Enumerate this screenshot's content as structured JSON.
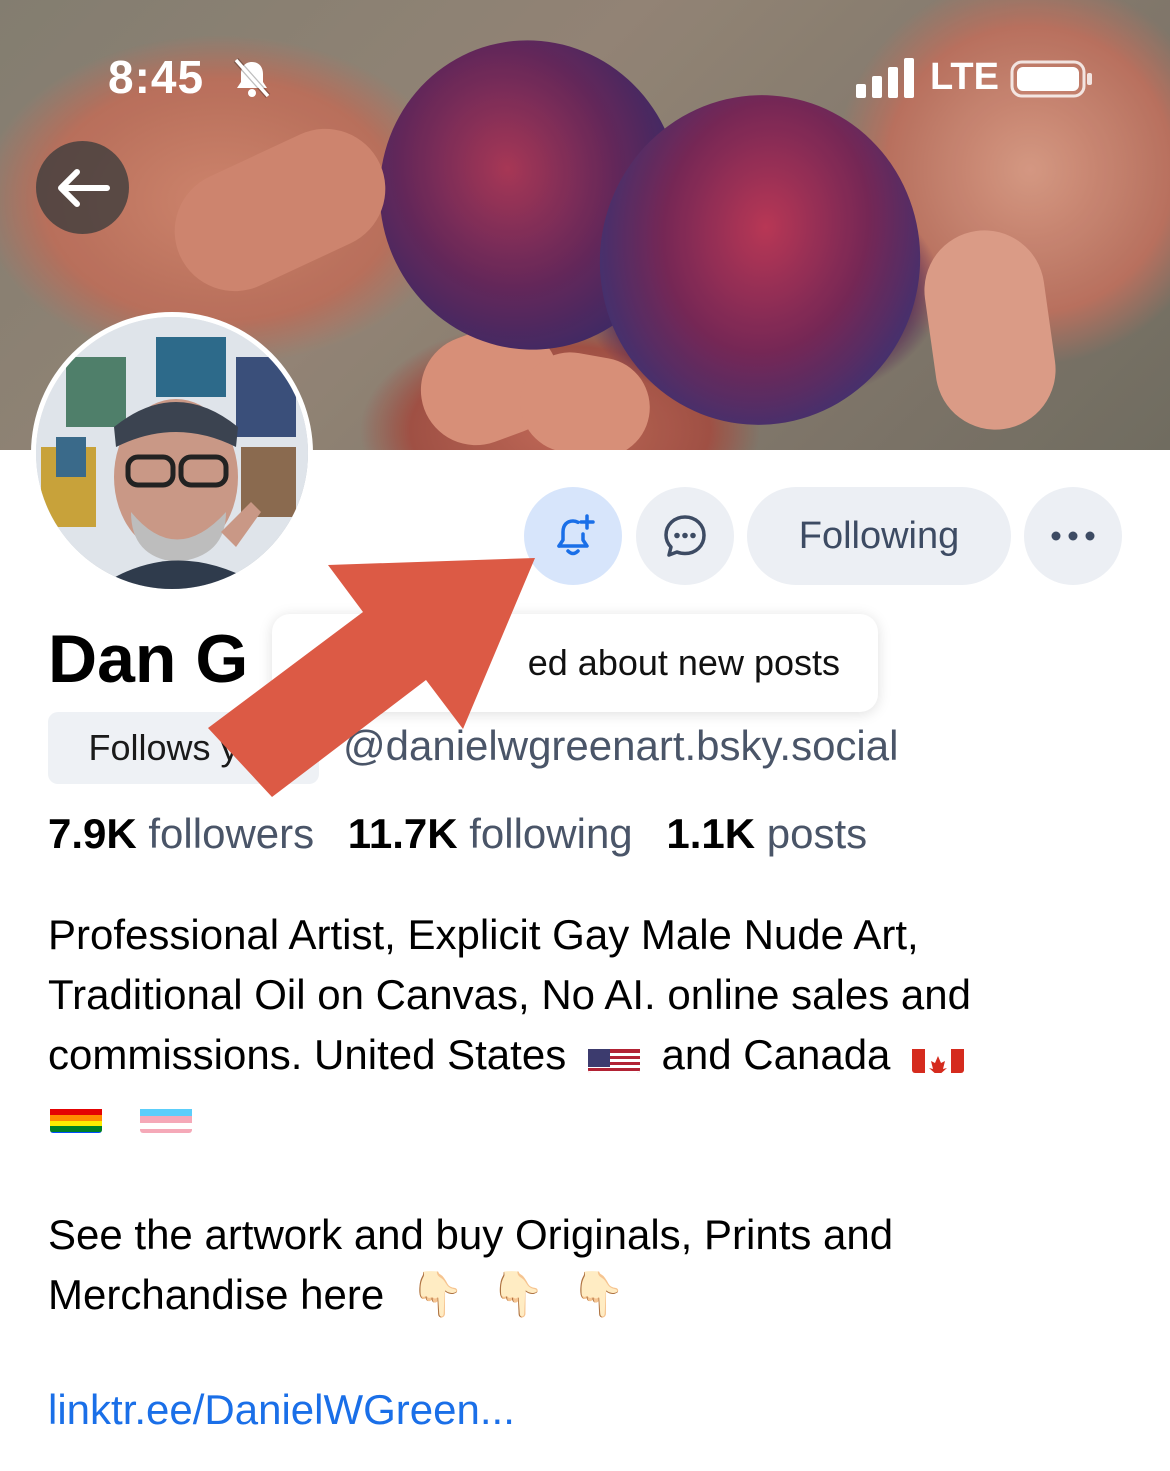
{
  "status_bar": {
    "time": "8:45",
    "network": "LTE",
    "icons": [
      "bell-slash-icon",
      "signal-icon",
      "battery-icon"
    ]
  },
  "profile": {
    "display_name": "Dan G",
    "follows_you_label": "Follows you",
    "handle": "@danielwgreenart.bsky.social",
    "stats": {
      "followers_count": "7.9K",
      "followers_label": "followers",
      "following_count": "11.7K",
      "following_label": "following",
      "posts_count": "1.1K",
      "posts_label": "posts"
    },
    "bio": {
      "line1": "Professional Artist, Explicit Gay Male Nude Art,",
      "line2": "Traditional Oil on Canvas, No AI. online sales and",
      "line3_a": "commissions. United States",
      "line3_b": "and Canada",
      "paragraph2_line1": "See the artwork and buy Originals, Prints and",
      "paragraph2_line2": "Merchandise here",
      "emoji_pointer": "👇🏻",
      "flags": [
        "us-flag",
        "canada-flag",
        "rainbow-flag",
        "transgender-flag"
      ]
    },
    "link": "linktr.ee/DanielWGreen..."
  },
  "actions": {
    "notify_icon": "bell-plus-icon",
    "message_icon": "chat-bubble-icon",
    "following_label": "Following",
    "more_icon": "ellipsis-icon"
  },
  "tooltip": {
    "text": "ed about new posts"
  },
  "colors": {
    "accent": "#1a6fe8",
    "notify_bg": "#d7e5fb",
    "button_bg": "#eceff4",
    "annotation_arrow": "#dc5a45"
  }
}
